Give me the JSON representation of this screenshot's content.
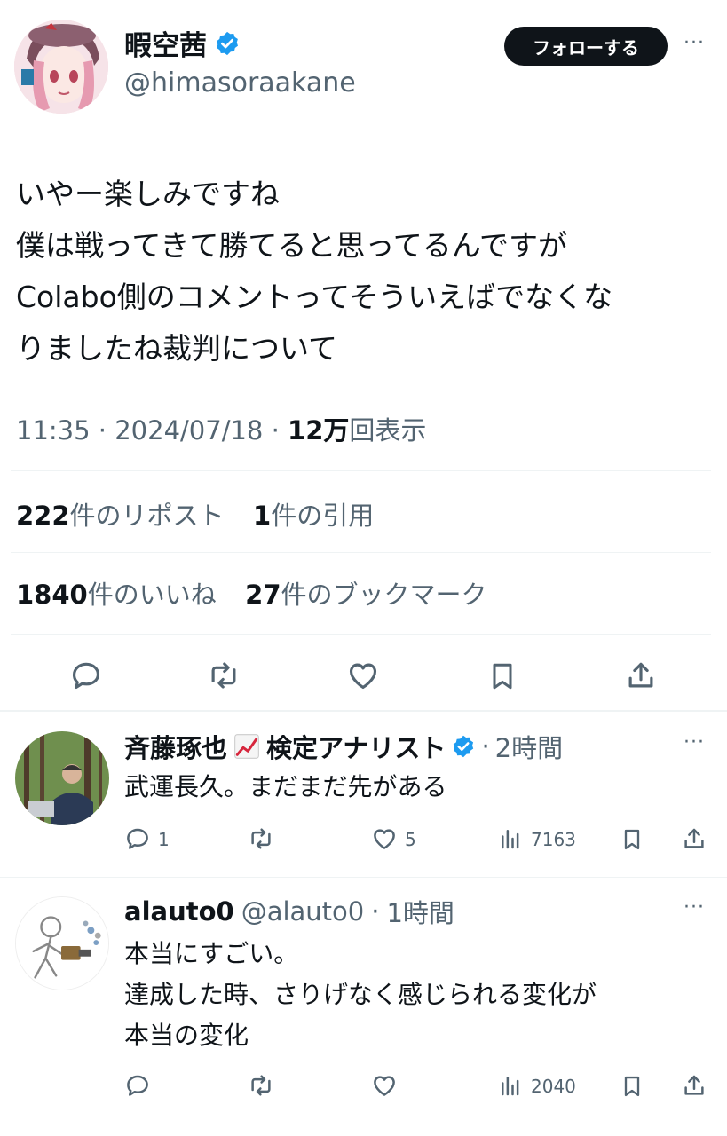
{
  "author": {
    "display_name": "暇空茜",
    "handle": "@himasoraakane",
    "verified": true
  },
  "follow_button": "フォローする",
  "tweet": {
    "lines": [
      "いやー楽しみですね",
      "僕は戦ってきて勝てると思ってるんですが",
      "Colabo側のコメントってそういえばでなくな",
      "りましたね裁判について"
    ],
    "time": "11:35",
    "sep": "·",
    "date": "2024/07/18",
    "views_num": "12万",
    "views_label": "回表示"
  },
  "stats": {
    "reposts_num": "222",
    "reposts_label": "件のリポスト",
    "quotes_num": "1",
    "quotes_label": "件の引用",
    "likes_num": "1840",
    "likes_label": "件のいいね",
    "bookmarks_num": "27",
    "bookmarks_label": "件のブックマーク"
  },
  "replies": [
    {
      "name_part1": "斉藤琢也",
      "emoji_icon": "chart-increasing-icon",
      "name_part2": "検定アナリスト",
      "verified": true,
      "sep": "·",
      "time": "2時間",
      "text": [
        "武運長久。まだまだ先がある"
      ],
      "reply_count": "1",
      "like_count": "5",
      "view_count": "7163"
    },
    {
      "name": "alauto0",
      "handle": "@alauto0",
      "sep": "·",
      "time": "1時間",
      "text": [
        "本当にすごい。",
        "達成した時、さりげなく感じられる変化が",
        "本当の変化"
      ],
      "view_count": "2040"
    }
  ],
  "colors": {
    "verified_blue": "#1d9bf0",
    "text": "#0f1419",
    "muted": "#536471",
    "divider": "#eff3f4"
  }
}
